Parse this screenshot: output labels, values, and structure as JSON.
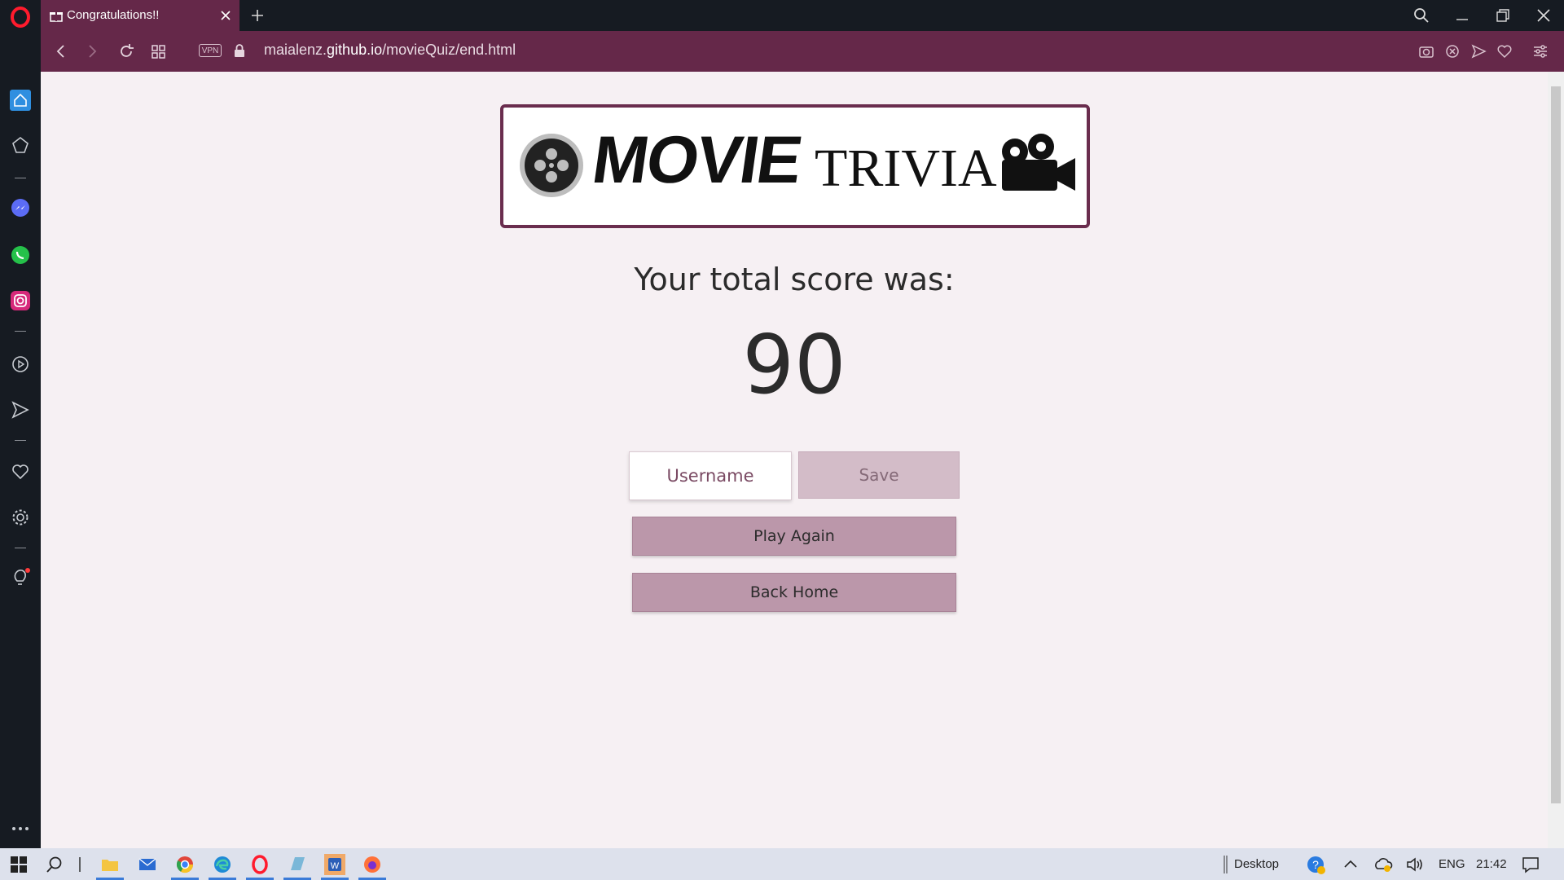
{
  "browser": {
    "tab_title": "Congratulations!!",
    "url_prefix": "maialenz.",
    "url_domain": "github.io",
    "url_path": "/movieQuiz/end.html",
    "vpn_label": "VPN"
  },
  "logo": {
    "word1": "MOVIE",
    "word2": "TRIVIA"
  },
  "page": {
    "score_label": "Your total score was:",
    "score_value": "90",
    "username_placeholder": "Username",
    "save_label": "Save",
    "play_again_label": "Play Again",
    "back_home_label": "Back Home"
  },
  "taskbar": {
    "desktop_label": "Desktop",
    "language": "ENG",
    "time": "21:42"
  },
  "colors": {
    "accent": "#652849",
    "page_bg": "#f6f0f3",
    "button": "#bb97aa",
    "save_button": "#d3bcc8"
  }
}
